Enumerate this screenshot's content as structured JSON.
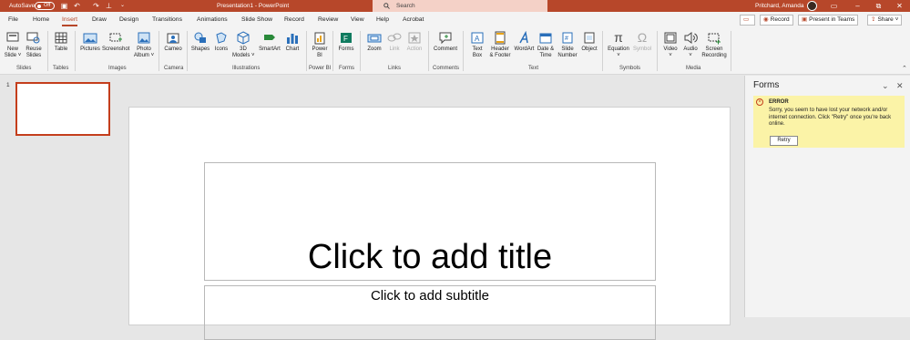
{
  "titlebar": {
    "autosave_label": "AutoSave",
    "autosave_state": "Off",
    "doc_title": "Presentation1  -  PowerPoint",
    "search_placeholder": "Search",
    "user_name": "Pritchard, Amanda"
  },
  "tabs": [
    "File",
    "Home",
    "Insert",
    "Draw",
    "Design",
    "Transitions",
    "Animations",
    "Slide Show",
    "Record",
    "Review",
    "View",
    "Help",
    "Acrobat"
  ],
  "active_tab": "Insert",
  "right_buttons": {
    "record": "Record",
    "present": "Present in Teams",
    "share": "Share"
  },
  "ribbon": {
    "new_slide": "New\nSlide ˅",
    "reuse": "Reuse\nSlides",
    "table": "Table",
    "pictures": "Pictures",
    "screenshot": "Screenshot",
    "photo_album": "Photo\nAlbum ˅",
    "cameo": "Cameo",
    "shapes": "Shapes",
    "icons": "Icons",
    "models3d": "3D\nModels ˅",
    "smartart": "SmartArt",
    "chart": "Chart",
    "powerbi": "Power\nBI",
    "forms": "Forms",
    "zoom": "Zoom",
    "link": "Link",
    "action": "Action",
    "comment": "Comment",
    "textbox": "Text\nBox",
    "header_footer": "Header\n& Footer",
    "wordart": "WordArt",
    "datetime": "Date &\nTime",
    "slide_number": "Slide\nNumber",
    "object": "Object",
    "equation": "Equation",
    "symbol": "Symbol",
    "video": "Video",
    "audio": "Audio",
    "screen_rec": "Screen\nRecording",
    "groups": {
      "slides": "Slides",
      "tables": "Tables",
      "images": "Images",
      "camera": "Camera",
      "illustrations": "Illustrations",
      "powerbi": "Power BI",
      "forms": "Forms",
      "links": "Links",
      "comments": "Comments",
      "text": "Text",
      "symbols": "Symbols",
      "media": "Media"
    }
  },
  "thumb_number": "1",
  "slide": {
    "title_placeholder": "Click to add title",
    "subtitle_placeholder": "Click to add subtitle"
  },
  "pane": {
    "title": "Forms",
    "error_heading": "ERROR",
    "error_message": "Sorry, you seem to have lost your network and/or internet connection. Click \"Retry\" once you're back online.",
    "retry": "Retry"
  },
  "colors": {
    "accent": "#b7472a",
    "error_bg": "#fbf3a7"
  }
}
